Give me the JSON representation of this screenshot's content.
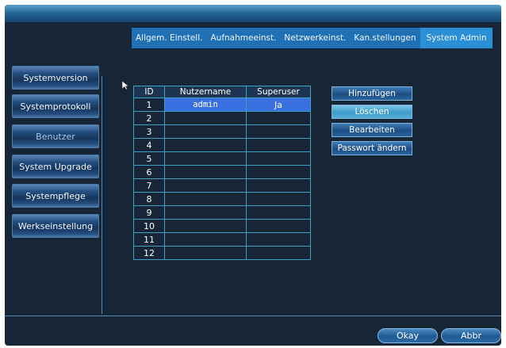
{
  "tabs": [
    "Allgem. Einstell.",
    "Aufnahmeeinst.",
    "Netzwerkeinst.",
    "Kan.stellungen",
    "System Admin"
  ],
  "sidebar": [
    "Systemversion",
    "Systemprotokoll",
    "Benutzer",
    "System Upgrade",
    "Systempflege",
    "Werkseinstellung"
  ],
  "table": {
    "headers": [
      "ID",
      "Nutzername",
      "Superuser"
    ],
    "rows": [
      [
        "1",
        "admin",
        "Ja"
      ],
      [
        "2",
        "",
        ""
      ],
      [
        "3",
        "",
        ""
      ],
      [
        "4",
        "",
        ""
      ],
      [
        "5",
        "",
        ""
      ],
      [
        "6",
        "",
        ""
      ],
      [
        "7",
        "",
        ""
      ],
      [
        "8",
        "",
        ""
      ],
      [
        "9",
        "",
        ""
      ],
      [
        "10",
        "",
        ""
      ],
      [
        "11",
        "",
        ""
      ],
      [
        "12",
        "",
        ""
      ]
    ]
  },
  "actions": [
    "Hinzufügen",
    "Löschen",
    "Bearbeiten",
    "Passwort ändern"
  ],
  "footer": {
    "ok": "Okay",
    "cancel": "Abbr"
  },
  "colors": {
    "accent": "#2b8fd8",
    "selection": "#3a6fe0",
    "background": "#162636"
  }
}
